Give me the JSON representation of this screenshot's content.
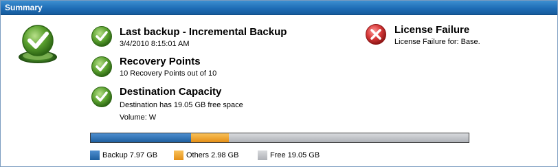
{
  "window": {
    "title": "Summary"
  },
  "status": {
    "last_backup": {
      "heading": "Last backup - Incremental Backup",
      "detail": "3/4/2010 8:15:01 AM"
    },
    "recovery_points": {
      "heading": "Recovery Points",
      "detail": "10 Recovery Points out of 10"
    },
    "destination": {
      "heading": "Destination Capacity",
      "detail": "Destination has 19.05 GB free space",
      "volume": "Volume: W"
    },
    "license": {
      "heading": "License Failure",
      "detail": "License Failure for: Base."
    }
  },
  "capacity": {
    "backup_gb": 7.97,
    "others_gb": 2.98,
    "free_gb": 19.05,
    "legend": {
      "backup_label": "Backup 7.97 GB",
      "others_label": "Others  2.98 GB",
      "free_label": "Free  19.05 GB"
    }
  },
  "colors": {
    "titlebar": "#1f6db6",
    "backup": "#2a6fb5",
    "others": "#f2a530",
    "free": "#c0c3c7",
    "ok_green": "#4a8f2a",
    "error_red": "#c62828"
  },
  "icons": {
    "overall": "large-checkmark-icon",
    "ok": "checkmark-icon",
    "error": "error-x-icon"
  }
}
